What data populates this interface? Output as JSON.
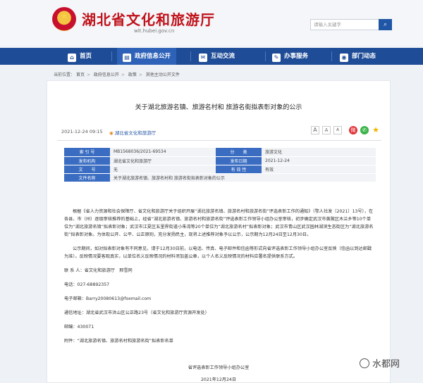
{
  "header": {
    "site_title": "湖北省文化和旅游厅",
    "site_url": "wlt.hubei.gov.cn",
    "search_placeholder": "请输入关键字",
    "search_icon": "search-icon"
  },
  "nav": [
    {
      "label": "首页",
      "icon": "home-icon"
    },
    {
      "label": "政府信息公开",
      "icon": "document-icon"
    },
    {
      "label": "互动交流",
      "icon": "chat-icon"
    },
    {
      "label": "办事服务",
      "icon": "service-icon"
    },
    {
      "label": "部门动态",
      "icon": "news-icon"
    }
  ],
  "breadcrumb": {
    "prefix": "当前位置：",
    "items": [
      "首页",
      "政府信息公开",
      "政策",
      "其他主动公开文件"
    ]
  },
  "article": {
    "title": "关于湖北旅游名镇、旅游名村和 旅游名街拟表彰对象的公示",
    "date": "2021-12-24 09:15",
    "source": "湖北省文化和旅游厅",
    "font_sizes": [
      "A",
      "A",
      "A"
    ]
  },
  "info_table": {
    "rows": [
      {
        "l1": "索 引 号",
        "v1": "MB1568036/2021-69534",
        "l2": "分　　类",
        "v2": "旅游文化"
      },
      {
        "l1": "发布机构",
        "v1": "湖北省文化和旅游厅",
        "l2": "发布日期",
        "v2": "2021-12-24"
      },
      {
        "l1": "文　　号",
        "v1": "无",
        "l2": "有 效 性",
        "v2": "有效"
      },
      {
        "l1": "文件名称",
        "v1": "关于湖北旅游名镇、旅游名村和 旅游名街拟表彰对象的公示",
        "l2": "",
        "v2": ""
      }
    ]
  },
  "body": {
    "p1": "根据《省人力资源和社会保障厅、省文化和旅游厅关于组织开展“湖北旅游名镇、旅游名村和旅游名街”评选表彰工作的通知》（鄂人社发〔2021〕13号），在各县、市（州）逐级审核推荐的基础上，经省“湖北旅游名镇、旅游名村和旅游名街”评选表彰工作领导小组办公室审核，初步确定武汉市黄陂区木兰乡等10个单位为“湖北旅游名镇”拟表彰对象；武汉市江夏区五里界街道小朱湾等20个单位为“湖北旅游名村”拟表彰对象；武汉市青山区武汉园林湖滨生态街区为“湖北旅游名街”拟表彰对象。为体现公开、公平、公正原则，充分发扬民主，现将上述推荐对象予以公示，公示期为12月24日至12月30日。",
    "p2": "公示期间，如对拟表彰对象有不同意见，请于12月30日前，以电话、传真、电子邮件和信函等形式向省评选表彰工作领导小组办公室反映（信函以到达邮戳为准）。反映情况要客观真实，以单位名义反映情况的材料须加盖公章，以个人名义反映情况的材料应署名提供联系方式。",
    "contact": "联 系 人：省文化和旅游厅　邢雪同",
    "phone": "电话：027-68892357",
    "email": "电子邮箱：Barry20080613@foxmail.com",
    "address": "通信地址：湖北省武汉市洪山区公正路23号（省文化和旅游厅资源开发处）",
    "postcode": "邮编：430071",
    "attachment": "附件：“湖北旅游名镇、旅游名村和旅游名街”拟表彰名单",
    "signature": "省评选表彰工作领导小组办公室",
    "sign_date": "2021年12月24日"
  },
  "watermark": {
    "text": "水都网",
    "icon": "wechat-channel-icon"
  },
  "colors": {
    "brand_red": "#c0121a",
    "nav_blue": "#1e4c97",
    "label_blue": "#3a6dc2"
  }
}
